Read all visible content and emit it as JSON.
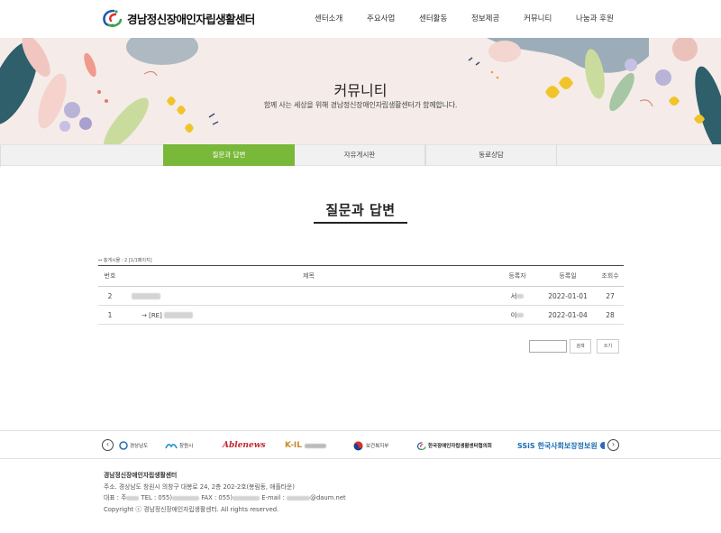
{
  "header": {
    "logo_text": "경남정신장애인자립생활센터",
    "nav": [
      "센터소개",
      "주요사업",
      "센터활동",
      "정보제공",
      "커뮤니티",
      "나눔과 후원"
    ]
  },
  "visual": {
    "title": "커뮤니티",
    "subtitle": "함께 사는 세상을 위해 경남정신장애인자립생활센터가 함께합니다."
  },
  "subtabs": [
    "질문과 답변",
    "자유게시판",
    "동료상담"
  ],
  "page_title": "질문과 답변",
  "board": {
    "info": "↔ 총게시물 : 2 [1/1페이지]",
    "columns": [
      "번호",
      "제목",
      "등록자",
      "등록일",
      "조회수"
    ],
    "rows": [
      {
        "no": "2",
        "title_prefix": "",
        "writer_initial": "서",
        "date": "2022-01-01",
        "hits": "27"
      },
      {
        "no": "1",
        "title_prefix": "→ [RE]",
        "writer_initial": "이",
        "date": "2022-01-04",
        "hits": "28"
      }
    ]
  },
  "search": {
    "search_label": "검색",
    "write_label": "쓰기"
  },
  "partners": {
    "prev": "‹",
    "next": "›",
    "items": [
      "경상남도",
      "창원시",
      "Ablenews",
      "K-IL",
      "보건복지부",
      "한국장애인자립생활센터협의회",
      "SSiS 한국사회보장정보원",
      ""
    ]
  },
  "footer": {
    "name": "경남정신장애인자립생활센터",
    "address": "주소. 경상남도 창원시 의창구 대봉로 24, 2층 202-2호(봉림동, 애플타운)",
    "contact_prefix": "대표 : 주",
    "contact_tel": "TEL : 055)",
    "contact_fax": "FAX : 055)",
    "contact_email_label": "E-mail :",
    "contact_email_domain": "@daum.net",
    "copyright": "Copyright ⓒ 경남정신장애인자립생활센터. All rights reserved."
  },
  "colors": {
    "accent": "#7ab83a",
    "banner_bg": "#f5ece9"
  }
}
